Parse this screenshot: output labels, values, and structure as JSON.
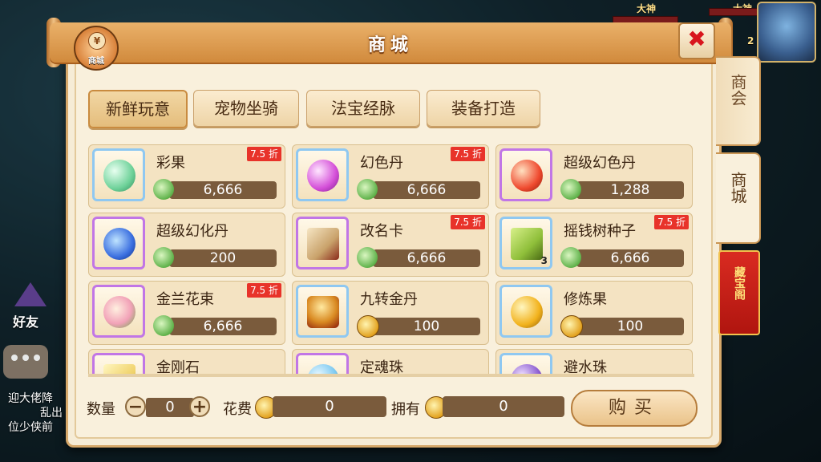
{
  "window": {
    "title": "商城"
  },
  "badge": {
    "coin_symbol": "¥",
    "label": "商城"
  },
  "hud": {
    "name1": "大神",
    "name2": "大神",
    "counter": "2"
  },
  "side_tabs": [
    {
      "label": "商会"
    },
    {
      "label": "商城"
    },
    {
      "label": "藏宝阁"
    }
  ],
  "left_ui": {
    "friend_label": "好友",
    "chat_lines": [
      "迎大佬降",
      "乱出",
      "位少侠前"
    ]
  },
  "categories": [
    {
      "label": "新鲜玩意",
      "active": true
    },
    {
      "label": "宠物坐骑",
      "active": false
    },
    {
      "label": "法宝经脉",
      "active": false
    },
    {
      "label": "装备打造",
      "active": false
    }
  ],
  "items": [
    {
      "name": "彩果",
      "price": "6,666",
      "discount": "7.5 折",
      "currency": "jade",
      "frame": "blue",
      "icon_color": "#6fd29a",
      "qty": ""
    },
    {
      "name": "幻色丹",
      "price": "6,666",
      "discount": "7.5 折",
      "currency": "jade",
      "frame": "blue",
      "icon_color": "#d44fd8",
      "qty": ""
    },
    {
      "name": "超级幻色丹",
      "price": "1,288",
      "discount": "",
      "currency": "jade",
      "frame": "purple",
      "icon_color": "#ef4a2f",
      "qty": ""
    },
    {
      "name": "超级幻化丹",
      "price": "200",
      "discount": "",
      "currency": "jade",
      "frame": "purple",
      "icon_color": "#3b6fe0",
      "qty": ""
    },
    {
      "name": "改名卡",
      "price": "6,666",
      "discount": "7.5 折",
      "currency": "jade",
      "frame": "purple",
      "icon_color": "#c9a26b",
      "qty": ""
    },
    {
      "name": "摇钱树种子",
      "price": "6,666",
      "discount": "7.5 折",
      "currency": "jade",
      "frame": "blue",
      "icon_color": "#8fbf3a",
      "qty": "3"
    },
    {
      "name": "金兰花束",
      "price": "6,666",
      "discount": "7.5 折",
      "currency": "jade",
      "frame": "purple",
      "icon_color": "#f2a2b8",
      "qty": ""
    },
    {
      "name": "九转金丹",
      "price": "100",
      "discount": "",
      "currency": "gold",
      "frame": "blue",
      "icon_color": "#d98a22",
      "qty": ""
    },
    {
      "name": "修炼果",
      "price": "100",
      "discount": "",
      "currency": "gold",
      "frame": "blue",
      "icon_color": "#f2b21c",
      "qty": ""
    },
    {
      "name": "金刚石",
      "price": "",
      "discount": "",
      "currency": "",
      "frame": "purple",
      "icon_color": "#f0d26a",
      "qty": ""
    },
    {
      "name": "定魂珠",
      "price": "",
      "discount": "",
      "currency": "",
      "frame": "purple",
      "icon_color": "#7ac8f0",
      "qty": ""
    },
    {
      "name": "避水珠",
      "price": "",
      "discount": "",
      "currency": "",
      "frame": "blue",
      "icon_color": "#8a5ad0",
      "qty": ""
    }
  ],
  "bottom": {
    "qty_label": "数量",
    "qty_value": "0",
    "minus": "−",
    "plus": "+",
    "cost_label": "花费",
    "cost_value": "0",
    "own_label": "拥有",
    "own_value": "0",
    "buy_label": "购买"
  },
  "close": {
    "glyph": "✖"
  }
}
